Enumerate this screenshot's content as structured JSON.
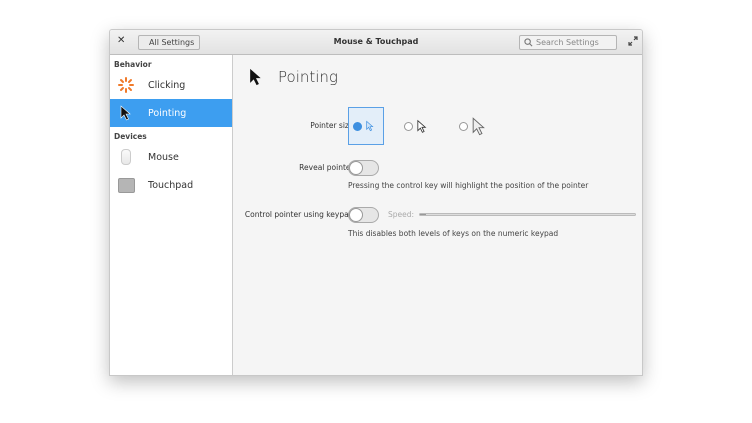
{
  "header": {
    "close_icon": "close-icon",
    "back_label": "All Settings",
    "title": "Mouse & Touchpad",
    "search_placeholder": "Search Settings",
    "maximize_icon": "maximize-icon"
  },
  "sidebar": {
    "sections": [
      {
        "title": "Behavior",
        "items": [
          {
            "label": "Clicking",
            "icon": "clicking-icon"
          },
          {
            "label": "Pointing",
            "icon": "pointer-icon",
            "selected": true
          }
        ]
      },
      {
        "title": "Devices",
        "items": [
          {
            "label": "Mouse",
            "icon": "mouse-icon"
          },
          {
            "label": "Touchpad",
            "icon": "touchpad-icon"
          }
        ]
      }
    ]
  },
  "main": {
    "title": "Pointing",
    "pointer_size": {
      "label": "Pointer size:",
      "options": [
        "small",
        "medium",
        "large"
      ],
      "selected": "small"
    },
    "reveal_pointer": {
      "label": "Reveal pointer:",
      "on": false,
      "hint": "Pressing the control key will highlight the position of the pointer"
    },
    "keypad": {
      "label": "Control pointer using keypad:",
      "on": false,
      "speed_label": "Speed:",
      "speed_percent": 3,
      "speed_enabled": false,
      "hint": "This disables both levels of keys on the numeric keypad"
    }
  },
  "colors": {
    "accent": "#3d9ef0",
    "clicking_icon": "#f07a2a"
  }
}
